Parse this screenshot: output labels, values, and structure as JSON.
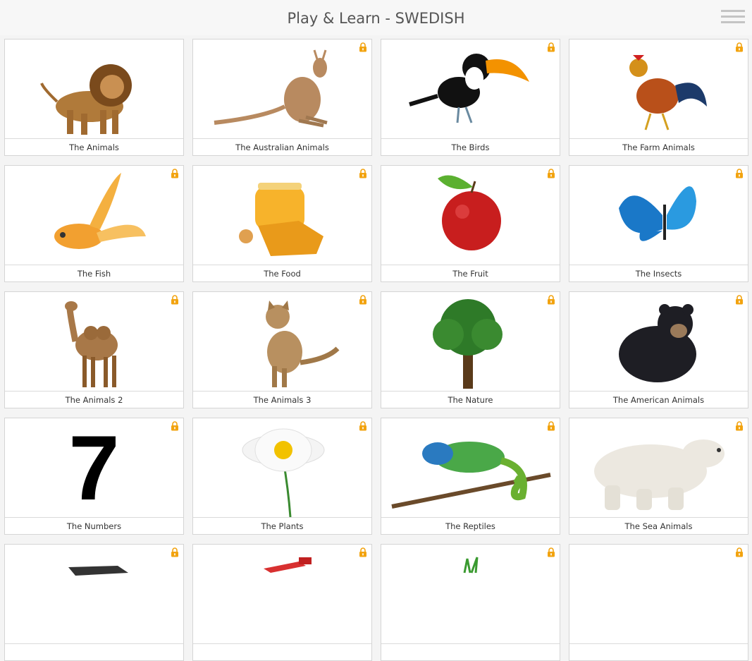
{
  "header": {
    "title": "Play & Learn - SWEDISH",
    "menu_icon": "hamburger-menu-icon"
  },
  "tiles": [
    {
      "label": "The Animals",
      "icon": "lion-icon",
      "locked": false
    },
    {
      "label": "The Australian Animals",
      "icon": "kangaroo-icon",
      "locked": true
    },
    {
      "label": "The Birds",
      "icon": "toucan-icon",
      "locked": true
    },
    {
      "label": "The Farm Animals",
      "icon": "rooster-icon",
      "locked": true
    },
    {
      "label": "The Fish",
      "icon": "goldfish-icon",
      "locked": true
    },
    {
      "label": "The Food",
      "icon": "honey-icon",
      "locked": true
    },
    {
      "label": "The Fruit",
      "icon": "apple-icon",
      "locked": true
    },
    {
      "label": "The Insects",
      "icon": "butterfly-icon",
      "locked": true
    },
    {
      "label": "The Animals 2",
      "icon": "camel-icon",
      "locked": true
    },
    {
      "label": "The Animals 3",
      "icon": "cat-icon",
      "locked": true
    },
    {
      "label": "The Nature",
      "icon": "tree-icon",
      "locked": true
    },
    {
      "label": "The American Animals",
      "icon": "bear-icon",
      "locked": true
    },
    {
      "label": "The Numbers",
      "icon": "number-seven-icon",
      "locked": true,
      "glyph": "7"
    },
    {
      "label": "The Plants",
      "icon": "daisy-icon",
      "locked": true
    },
    {
      "label": "The Reptiles",
      "icon": "chameleon-icon",
      "locked": true
    },
    {
      "label": "The Sea Animals",
      "icon": "polar-bear-icon",
      "locked": true
    },
    {
      "label": "",
      "icon": "box-icon",
      "locked": true
    },
    {
      "label": "",
      "icon": "paint-icon",
      "locked": true
    },
    {
      "label": "",
      "icon": "grass-icon",
      "locked": true
    },
    {
      "label": "",
      "icon": "blank-icon",
      "locked": true
    }
  ],
  "colors": {
    "lock": "#f2a30f",
    "header_text": "#555555",
    "accent": "#f2a30f"
  }
}
